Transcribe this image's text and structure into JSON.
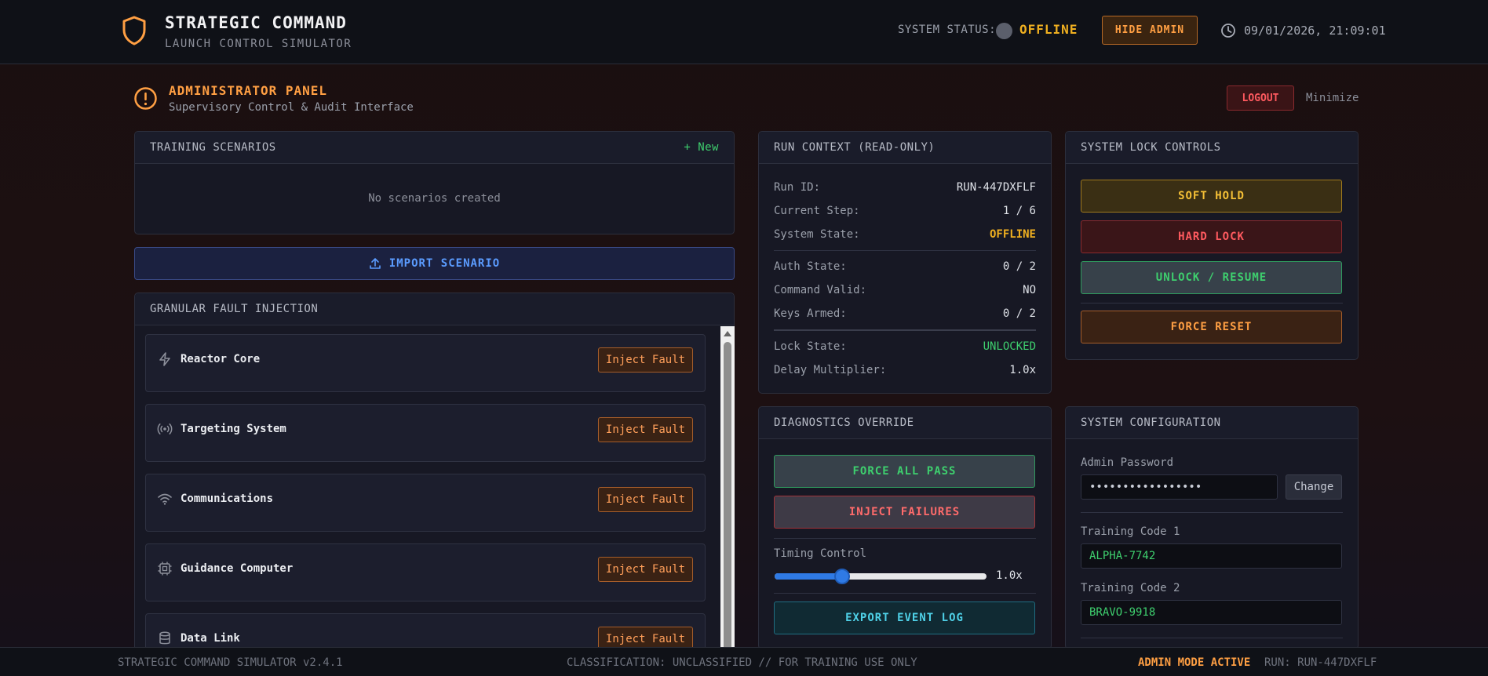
{
  "header": {
    "title": "STRATEGIC COMMAND",
    "subtitle": "LAUNCH CONTROL SIMULATOR",
    "status_label": "SYSTEM STATUS:",
    "status_value": "OFFLINE",
    "hide_admin_label": "HIDE ADMIN",
    "datetime": "09/01/2026, 21:09:01"
  },
  "admin_panel": {
    "title": "ADMINISTRATOR PANEL",
    "subtitle": "Supervisory Control & Audit Interface",
    "logout_label": "LOGOUT",
    "minimize_label": "Minimize"
  },
  "training_scenarios": {
    "title": "TRAINING SCENARIOS",
    "new_label": "+ New",
    "empty_message": "No scenarios created"
  },
  "import_scenario": {
    "label": "IMPORT SCENARIO"
  },
  "fault_injection": {
    "title": "GRANULAR FAULT INJECTION",
    "button_label": "Inject Fault",
    "items": [
      {
        "name": "Reactor Core",
        "icon": "lightning-icon"
      },
      {
        "name": "Targeting System",
        "icon": "broadcast-icon"
      },
      {
        "name": "Communications",
        "icon": "wifi-icon"
      },
      {
        "name": "Guidance Computer",
        "icon": "cpu-icon"
      },
      {
        "name": "Data Link",
        "icon": "database-icon"
      }
    ]
  },
  "run_context": {
    "title": "RUN CONTEXT (READ-ONLY)",
    "rows": [
      {
        "label": "Run ID:",
        "value": "RUN-447DXFLF"
      },
      {
        "label": "Current Step:",
        "value": "1 / 6"
      },
      {
        "label": "System State:",
        "value": "OFFLINE"
      },
      {
        "label": "Auth State:",
        "value": "0 / 2"
      },
      {
        "label": "Command Valid:",
        "value": "NO"
      },
      {
        "label": "Keys Armed:",
        "value": "0 / 2"
      },
      {
        "label": "Lock State:",
        "value": "UNLOCKED"
      },
      {
        "label": "Delay Multiplier:",
        "value": "1.0x"
      }
    ]
  },
  "system_lock": {
    "title": "SYSTEM LOCK CONTROLS",
    "soft_hold": "SOFT HOLD",
    "hard_lock": "HARD LOCK",
    "unlock_resume": "UNLOCK / RESUME",
    "force_reset": "FORCE RESET"
  },
  "diagnostics": {
    "title": "DIAGNOSTICS OVERRIDE",
    "force_all_pass": "FORCE ALL PASS",
    "inject_failures": "INJECT FAILURES",
    "timing_label": "Timing Control",
    "timing_value_label": "1.0x",
    "timing_fraction": 0.32,
    "export_log": "EXPORT EVENT LOG"
  },
  "system_config": {
    "title": "SYSTEM CONFIGURATION",
    "admin_password_label": "Admin Password",
    "admin_password_value": "•••••••••••••••••",
    "change_label": "Change",
    "training_code_1_label": "Training Code 1",
    "training_code_1_value": "ALPHA-7742",
    "training_code_2_label": "Training Code 2",
    "training_code_2_value": "BRAVO-9918"
  },
  "footer": {
    "version": "STRATEGIC COMMAND SIMULATOR v2.4.1",
    "classification": "CLASSIFICATION: UNCLASSIFIED // FOR TRAINING USE ONLY",
    "admin_mode": "ADMIN MODE ACTIVE",
    "run": "RUN: RUN-447DXFLF"
  },
  "colors": {
    "accent_orange": "#ff9f43",
    "status_yellow": "#f0b020",
    "success_green": "#3ecf6e",
    "danger_red": "#ff5a5f",
    "info_blue": "#5b9cff"
  }
}
